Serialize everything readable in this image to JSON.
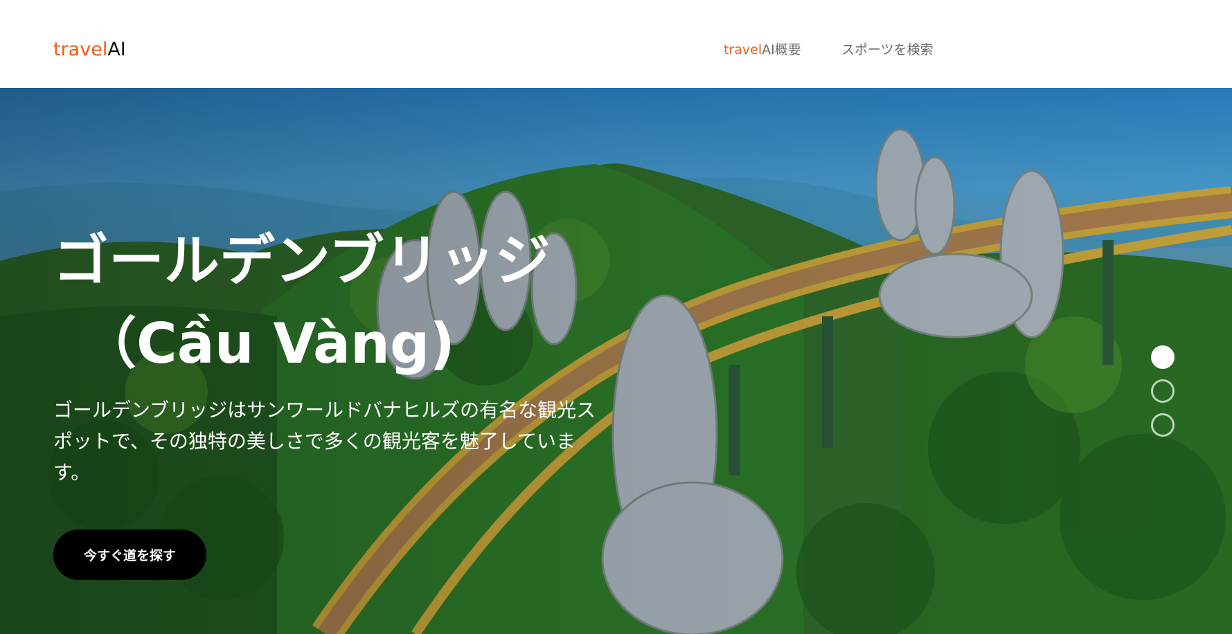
{
  "header": {
    "logo": {
      "accent": "travel",
      "rest": "AI"
    },
    "nav": {
      "about": {
        "accent": "travel",
        "rest": "AI概要"
      },
      "search": "スポーツを検索"
    }
  },
  "hero": {
    "title_line1": "ゴールデンブリッジ",
    "title_line2": "（Cầu Vàng)",
    "description": "ゴールデンブリッジはサンワールドバナヒルズの有名な観光スポットで、その独特の美しさで多くの観光客を魅了しています。",
    "cta_label": "今すぐ道を探す",
    "background_image": "Golden Bridge held by giant stone hands over forested mountains",
    "carousel": {
      "slides": 3,
      "active_index": 0
    }
  },
  "colors": {
    "accent": "#f05a1a",
    "nav_text": "#6b6b6b",
    "cta_bg": "#000000"
  }
}
